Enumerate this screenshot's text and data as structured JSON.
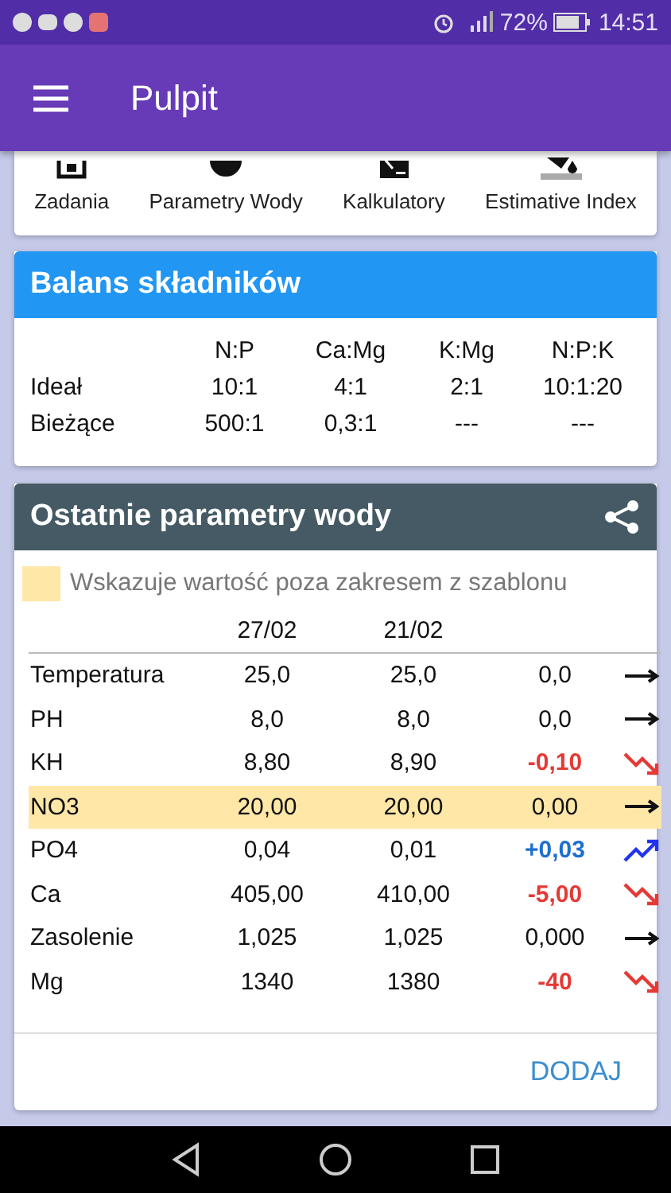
{
  "status_bar": {
    "battery_text": "72%",
    "time": "14:51"
  },
  "app_bar": {
    "title": "Pulpit"
  },
  "shortcuts": [
    {
      "label": "Zadania",
      "kind": "tasks"
    },
    {
      "label": "Parametry Wody",
      "kind": "water"
    },
    {
      "label": "Kalkulatory",
      "kind": "calc"
    },
    {
      "label": "Estimative Index",
      "kind": "index"
    }
  ],
  "balance": {
    "title": "Balans składników",
    "columns": [
      "N:P",
      "Ca:Mg",
      "K:Mg",
      "N:P:K"
    ],
    "rows": [
      {
        "label": "Ideał",
        "values": [
          "10:1",
          "4:1",
          "2:1",
          "10:1:20"
        ]
      },
      {
        "label": "Bieżące",
        "values": [
          "500:1",
          "0,3:1",
          "---",
          "---"
        ]
      }
    ]
  },
  "parameters": {
    "title": "Ostatnie parametry wody",
    "legend": "Wskazuje wartość poza zakresem z szablonu",
    "dates": [
      "27/02",
      "21/02"
    ],
    "rows": [
      {
        "name": "Temperatura",
        "current": "25,0",
        "previous": "25,0",
        "delta": "0,0",
        "kind": "flat",
        "out_of_range": false
      },
      {
        "name": "PH",
        "current": "8,0",
        "previous": "8,0",
        "delta": "0,0",
        "kind": "flat",
        "out_of_range": false
      },
      {
        "name": "KH",
        "current": "8,80",
        "previous": "8,90",
        "delta": "-0,10",
        "kind": "down",
        "out_of_range": false
      },
      {
        "name": "NO3",
        "current": "20,00",
        "previous": "20,00",
        "delta": "0,00",
        "kind": "flat",
        "out_of_range": true
      },
      {
        "name": "PO4",
        "current": "0,04",
        "previous": "0,01",
        "delta": "+0,03",
        "kind": "up",
        "out_of_range": false
      },
      {
        "name": "Ca",
        "current": "405,00",
        "previous": "410,00",
        "delta": "-5,00",
        "kind": "down",
        "out_of_range": false
      },
      {
        "name": "Zasolenie",
        "current": "1,025",
        "previous": "1,025",
        "delta": "0,000",
        "kind": "flat",
        "out_of_range": false
      },
      {
        "name": "Mg",
        "current": "1340",
        "previous": "1380",
        "delta": "-40",
        "kind": "down",
        "out_of_range": false
      }
    ],
    "action": "DODAJ"
  }
}
